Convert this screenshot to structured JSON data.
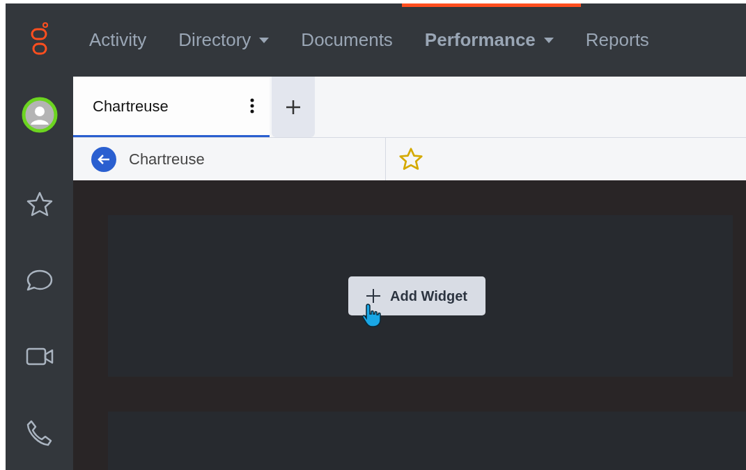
{
  "nav": [
    {
      "label": "Activity",
      "selected": false,
      "dropdown": false
    },
    {
      "label": "Directory",
      "selected": false,
      "dropdown": true
    },
    {
      "label": "Documents",
      "selected": false,
      "dropdown": false
    },
    {
      "label": "Performance",
      "selected": true,
      "dropdown": true
    },
    {
      "label": "Reports",
      "selected": false,
      "dropdown": false
    }
  ],
  "sidebar": {
    "online": true,
    "items": [
      {
        "kind": "star"
      },
      {
        "kind": "chat"
      },
      {
        "kind": "video"
      },
      {
        "kind": "phone"
      }
    ]
  },
  "tabs": [
    {
      "label": "Chartreuse",
      "selected": true
    }
  ],
  "breadcrumb": {
    "title": "Chartreuse",
    "favorite": false
  },
  "dashboard": {
    "add_button": "Add Widget"
  }
}
